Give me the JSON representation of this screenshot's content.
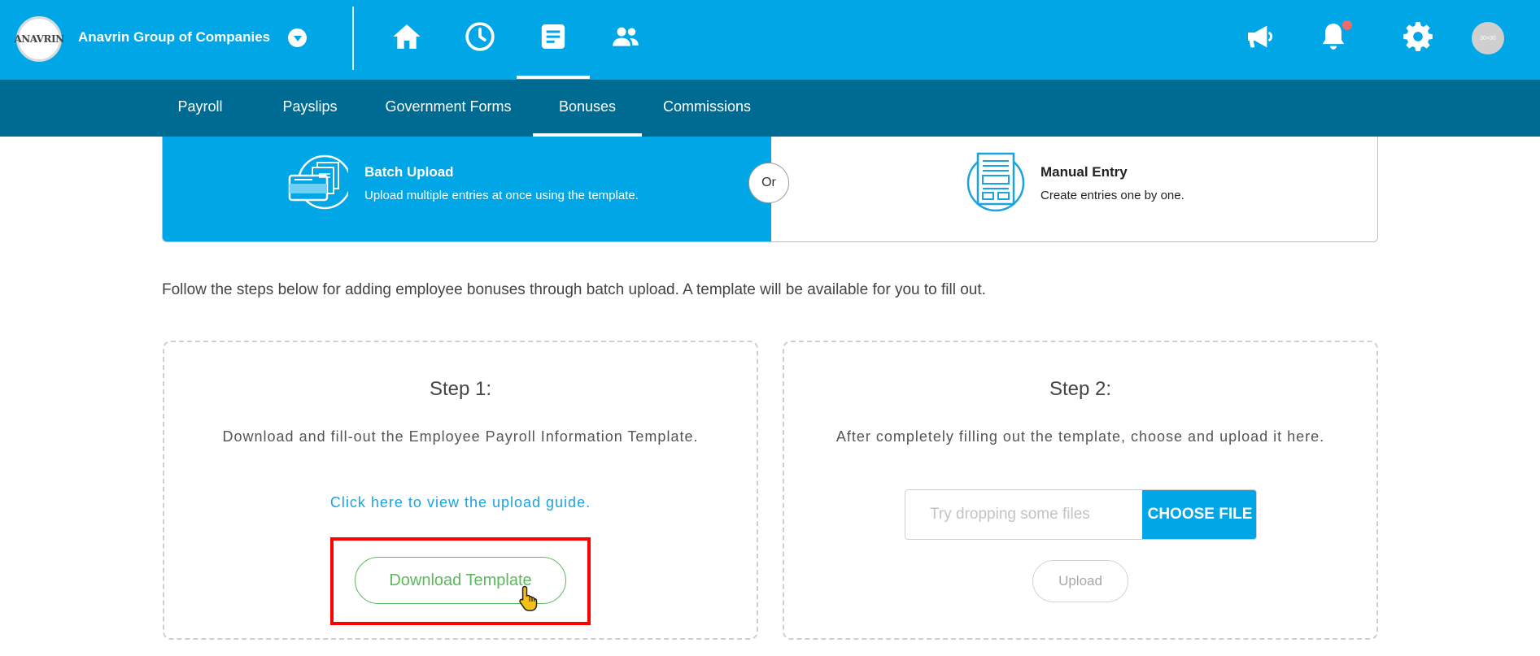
{
  "header": {
    "logo_text": "ANAVRIN",
    "company_name": "Anavrin Group of Companies",
    "nav_icons": [
      "home-icon",
      "clock-icon",
      "document-icon",
      "people-icon"
    ],
    "active_nav": "document-icon",
    "right_icons": [
      "megaphone-icon",
      "bell-icon",
      "gear-icon"
    ],
    "accent_color": "#00a6e6",
    "notification_color": "#ef6b6b"
  },
  "subnav": {
    "items": [
      {
        "label": "Payroll"
      },
      {
        "label": "Payslips"
      },
      {
        "label": "Government Forms"
      },
      {
        "label": "Bonuses"
      },
      {
        "label": "Commissions"
      }
    ],
    "active": "Bonuses",
    "background": "#006b92"
  },
  "modes": {
    "batch": {
      "title": "Batch Upload",
      "description": "Upload multiple entries at once using the template."
    },
    "or_label": "Or",
    "manual": {
      "title": "Manual Entry",
      "description": "Create entries one by one."
    },
    "selected": "batch"
  },
  "instructions": "Follow the steps below for adding employee bonuses through batch upload. A template will be available for you to fill out.",
  "step1": {
    "title": "Step 1:",
    "description": "Download and fill-out the Employee Payroll Information Template.",
    "guide_link": "Click here to view the upload guide.",
    "download_button": "Download Template"
  },
  "step2": {
    "title": "Step 2:",
    "description": "After completely filling out the template, choose and upload it here.",
    "file_placeholder": "Try dropping some files",
    "choose_button": "CHOOSE FILE",
    "upload_button": "Upload"
  }
}
